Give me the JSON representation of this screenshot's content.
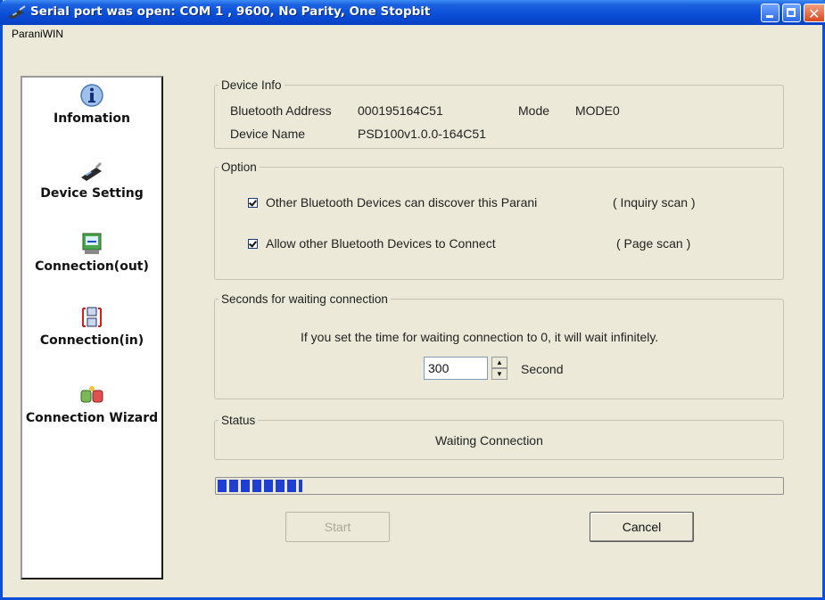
{
  "window": {
    "title": "Serial port was open: COM 1 , 9600, No Parity, One Stopbit",
    "title_icon": "serial-device-icon"
  },
  "menubar": {
    "app_name": "ParaniWIN"
  },
  "sidebar": {
    "items": [
      {
        "label": "Infomation",
        "icon": "info-icon"
      },
      {
        "label": "Device Setting",
        "icon": "usb-device-icon"
      },
      {
        "label": "Connection(out)",
        "icon": "connection-out-icon"
      },
      {
        "label": "Connection(in)",
        "icon": "connection-in-icon"
      },
      {
        "label": "Connection Wizard",
        "icon": "wizard-icon"
      }
    ]
  },
  "device_info": {
    "legend": "Device Info",
    "bt_address_label": "Bluetooth Address",
    "bt_address_value": "000195164C51",
    "mode_label": "Mode",
    "mode_value": "MODE0",
    "device_name_label": "Device Name",
    "device_name_value": "PSD100v1.0.0-164C51"
  },
  "option": {
    "legend": "Option",
    "discover_label": "Other Bluetooth Devices can discover this Parani",
    "discover_checked": true,
    "discover_note": "( Inquiry scan )",
    "connect_label": "Allow other Bluetooth Devices to Connect",
    "connect_checked": true,
    "connect_note": "( Page scan )"
  },
  "waiting": {
    "legend": "Seconds for waiting connection",
    "message": "If you set the time for waiting connection to 0, it will wait infinitely.",
    "value": "300",
    "unit": "Second"
  },
  "status": {
    "legend": "Status",
    "text": "Waiting Connection"
  },
  "progress": {
    "fraction": 0.15
  },
  "buttons": {
    "start": "Start",
    "cancel": "Cancel"
  },
  "colors": {
    "titlebar": "#0a4fd8",
    "progress": "#1f3fd3",
    "panel": "#ece9d8"
  }
}
